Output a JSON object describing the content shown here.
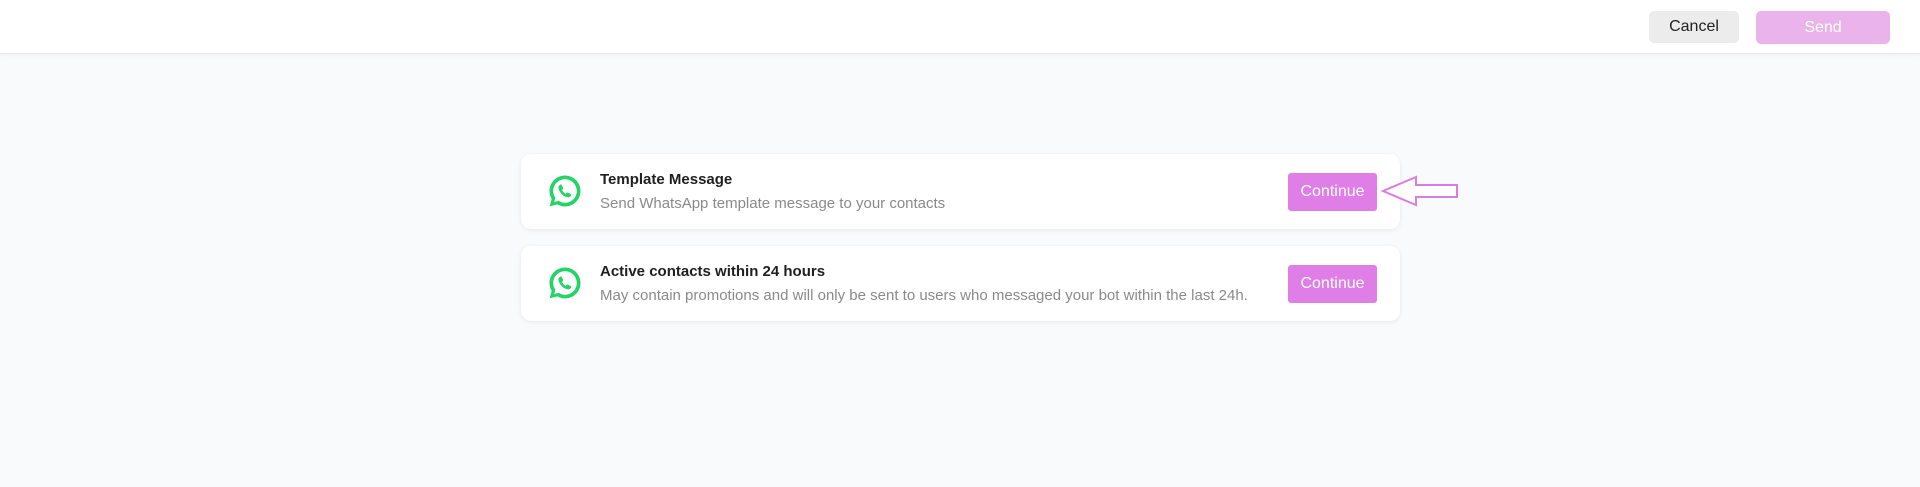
{
  "header": {
    "cancel_label": "Cancel",
    "send_label": "Send"
  },
  "options": [
    {
      "title": "Template Message",
      "description": "Send WhatsApp template message to your contacts",
      "button_label": "Continue",
      "icon": "whatsapp-icon"
    },
    {
      "title": "Active contacts within 24 hours",
      "description": "May contain promotions and will only be sent to users who messaged your bot within the last 24h.",
      "button_label": "Continue",
      "icon": "whatsapp-icon"
    }
  ],
  "colors": {
    "accent": "#e07ee8",
    "send_disabled": "#ebb3ec",
    "whatsapp_green": "#25d366",
    "annotation_arrow": "#d97ee0"
  }
}
